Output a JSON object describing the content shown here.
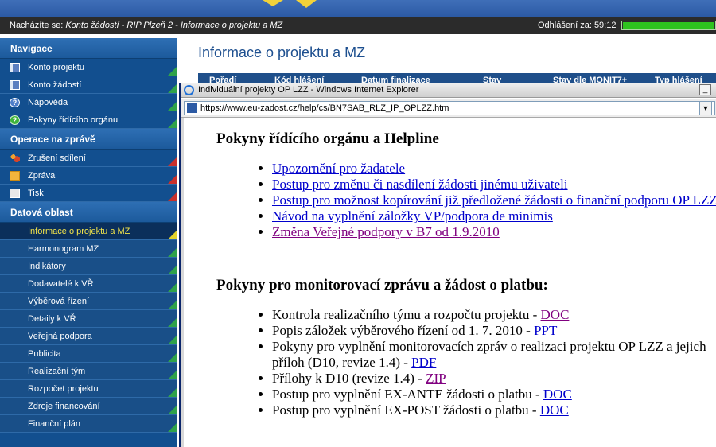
{
  "breadcrumb": {
    "prefix": "Nacházíte se:",
    "link": "Konto žádostí",
    "rest": "- RIP Plzeň 2 - Informace o projektu a MZ"
  },
  "logout": {
    "label": "Odhlášení za:",
    "time": "59:12",
    "progress_percent": 100
  },
  "sidebar": {
    "sections": [
      {
        "title": "Navigace",
        "items": [
          {
            "label": "Konto projektu",
            "icon": "book-icon"
          },
          {
            "label": "Konto žádostí",
            "icon": "book-icon"
          },
          {
            "label": "Nápověda",
            "icon": "help-icon"
          },
          {
            "label": "Pokyny řídícího orgánu",
            "icon": "green-help-icon"
          }
        ]
      },
      {
        "title": "Operace na zprávě",
        "items": [
          {
            "label": "Zrušení sdílení",
            "icon": "people-icon"
          },
          {
            "label": "Zpráva",
            "icon": "envelope-icon"
          },
          {
            "label": "Tisk",
            "icon": "print-icon"
          }
        ]
      },
      {
        "title": "Datová oblast",
        "items": [
          {
            "label": "Informace o projektu a MZ"
          },
          {
            "label": "Harmonogram MZ"
          },
          {
            "label": "Indikátory"
          },
          {
            "label": "Dodavatelé k VŘ"
          },
          {
            "label": "Výběrová řízení"
          },
          {
            "label": "Detaily k VŘ"
          },
          {
            "label": "Veřejná podpora"
          },
          {
            "label": "Publicita"
          },
          {
            "label": "Realizační tým"
          },
          {
            "label": "Rozpočet projektu"
          },
          {
            "label": "Zdroje financování"
          },
          {
            "label": "Finanční plán"
          }
        ]
      }
    ]
  },
  "main": {
    "title": "Informace o projektu a MZ",
    "table_headers": [
      "Pořadí",
      "Kód hlášení",
      "Datum finalizace",
      "Stav",
      "Stav dle MONIT7+",
      "Typ hlášení"
    ]
  },
  "popup": {
    "title": "Individuální projekty OP LZZ - Windows Internet Explorer",
    "url": "https://www.eu-zadost.cz/help/cs/BN7SAB_RLZ_IP_OPLZZ.htm",
    "section1": {
      "heading": "Pokyny řídícího orgánu a Helpline",
      "links": [
        "Upozornění pro žadatele",
        "Postup pro změnu či nasdílení žádosti jinému uživateli",
        "Postup pro možnost kopírování již předložené žádosti o finanční podporu OP LZZ",
        "Návod na vyplnění záložky VP/podpora de minimis",
        "Změna Veřejné podpory v B7 od 1.9.2010"
      ]
    },
    "section2": {
      "heading": "Pokyny pro monitorovací zprávu a žádost o platbu:",
      "items": [
        {
          "text": "Kontrola realizačního týmu a rozpočtu projektu - ",
          "link": "DOC"
        },
        {
          "text": "Popis záložek výběrového řízení od 1. 7. 2010 - ",
          "link": "PPT"
        },
        {
          "text": "Pokyny pro vyplnění monitorovacích zpráv o realizaci projektu OP LZZ a jejich příloh (D10, revize 1.4) - ",
          "link": "PDF"
        },
        {
          "text": "Přílohy k D10 (revize 1.4) - ",
          "link": "ZIP"
        },
        {
          "text": "Postup pro vyplnění EX-ANTE žádosti o platbu - ",
          "link": "DOC"
        },
        {
          "text": "Postup pro vyplnění EX-POST žádosti o platbu - ",
          "link": "DOC"
        }
      ]
    }
  }
}
